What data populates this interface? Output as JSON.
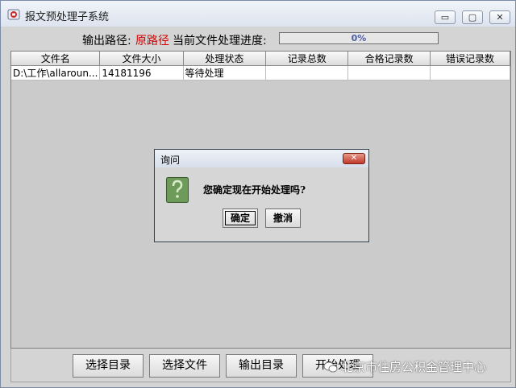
{
  "window": {
    "title": "报文预处理子系统",
    "minimize_glyph": "▭",
    "maximize_glyph": "▢",
    "close_glyph": "✕"
  },
  "path_row": {
    "output_label": "输出路径:",
    "output_value": "原路径",
    "progress_label": "当前文件处理进度:",
    "progress_text": "0%",
    "progress_fraction": 0
  },
  "table": {
    "columns": [
      "文件名",
      "文件大小",
      "处理状态",
      "记录总数",
      "合格记录数",
      "错误记录数"
    ],
    "rows": [
      [
        "D:\\工作\\allaroun...",
        "14181196",
        "等待处理",
        "",
        "",
        ""
      ]
    ]
  },
  "buttons": {
    "select_dir": "选择目录",
    "select_file": "选择文件",
    "output_dir": "输出目录",
    "start_process": "开始处理"
  },
  "watermark": {
    "text": "北京市住房公积金管理中心"
  },
  "dialog": {
    "title": "询问",
    "message": "您确定现在开始处理吗?",
    "ok_label": "确定",
    "cancel_label": "撤消",
    "icon": "question-icon"
  },
  "colors": {
    "path_value": "#d40000",
    "progress_text": "#4d5ea0",
    "close_red": "#c0392b"
  }
}
